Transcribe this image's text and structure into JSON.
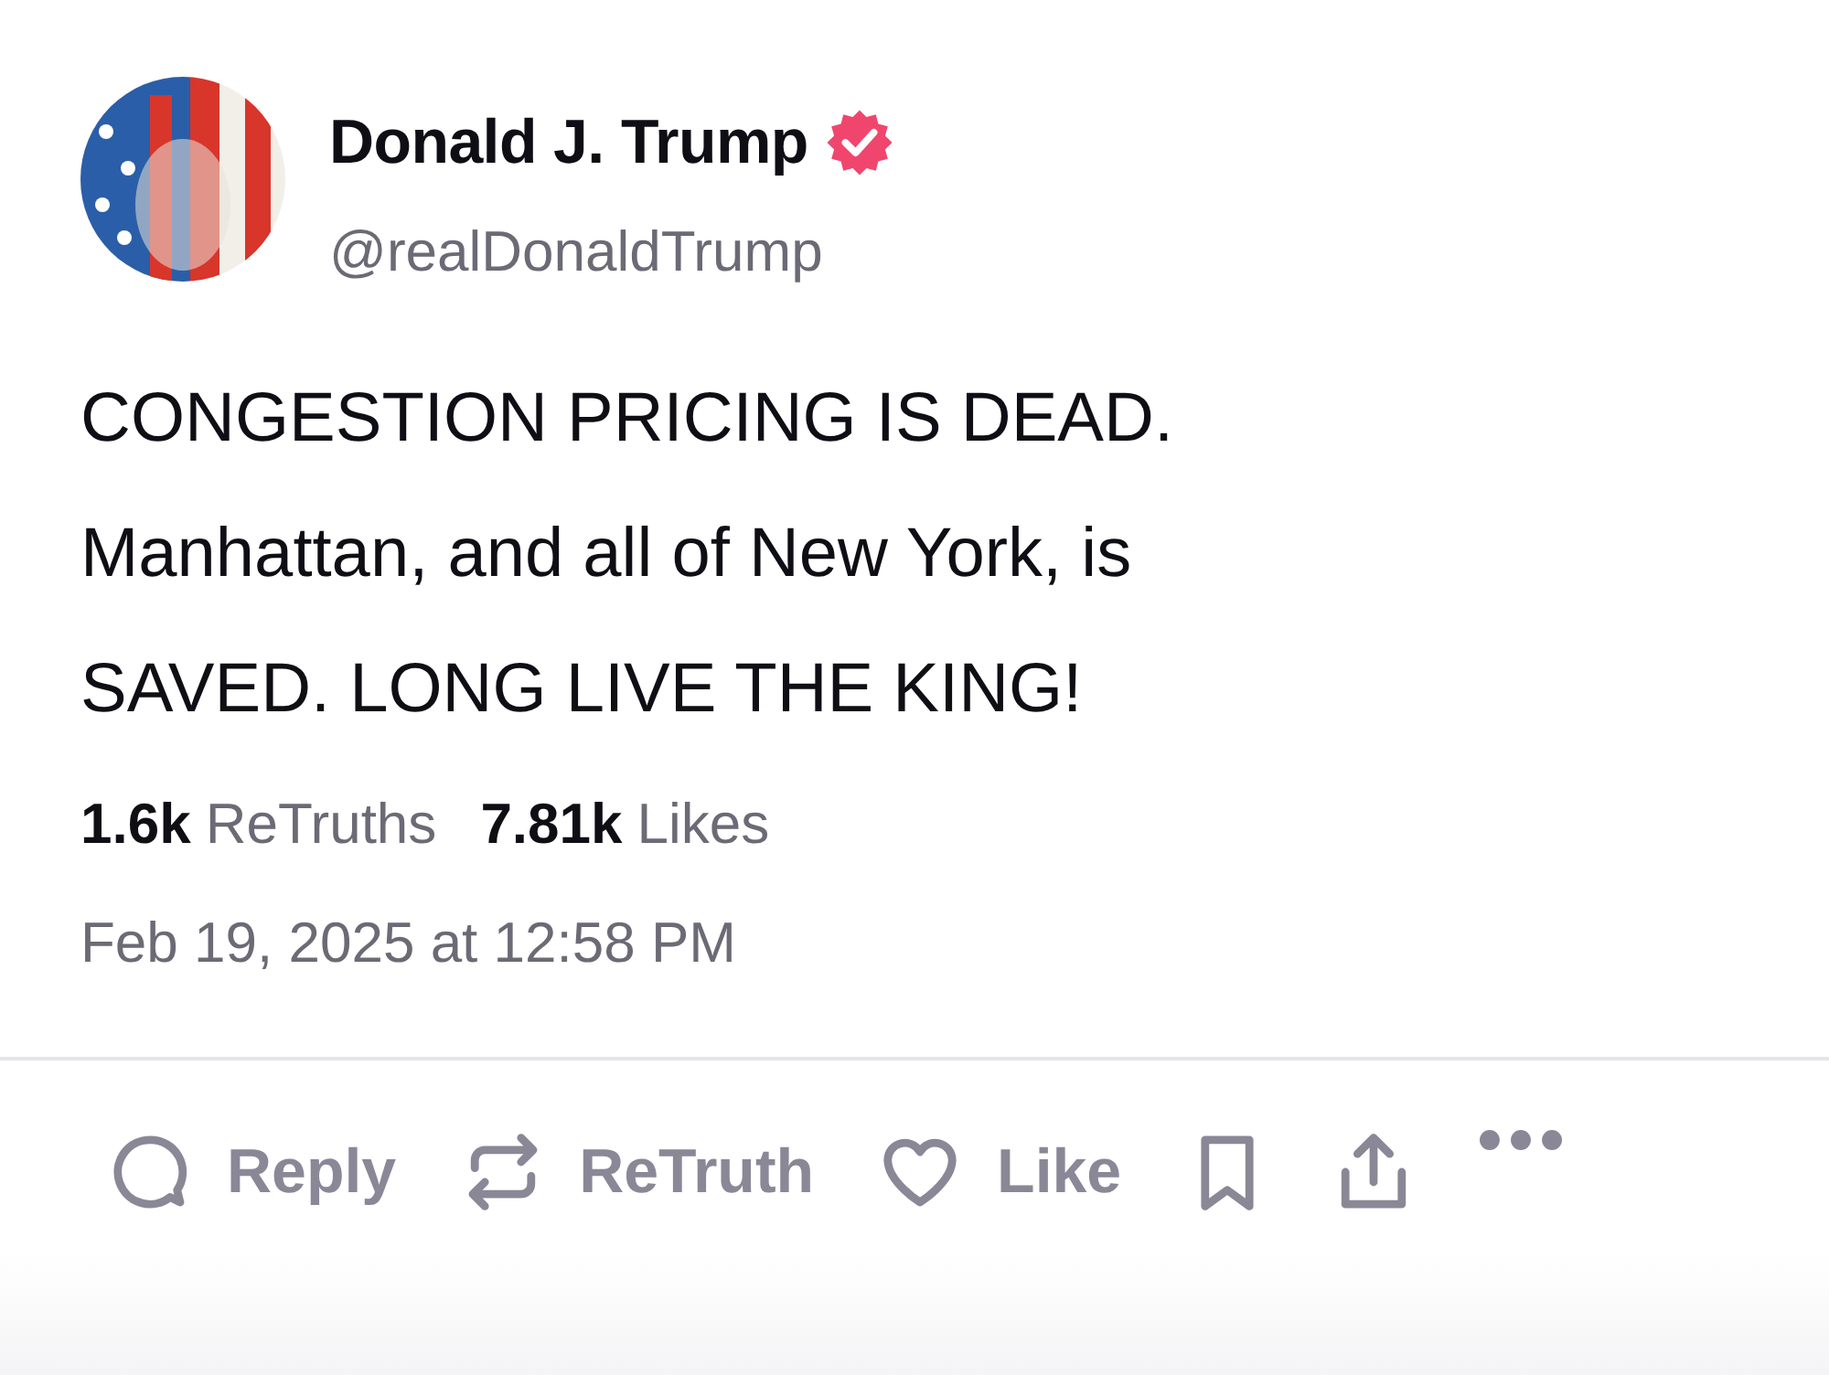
{
  "author": {
    "name": "Donald J. Trump",
    "verified": true,
    "handle": "@realDonaldTrump"
  },
  "post": {
    "lines": [
      "CONGESTION PRICING IS DEAD.",
      "Manhattan, and all of New York, is",
      "SAVED. LONG LIVE THE KING!"
    ]
  },
  "stats": [
    {
      "count": "1.6k",
      "label": "ReTruths"
    },
    {
      "count": "7.81k",
      "label": "Likes"
    }
  ],
  "timestamp": "Feb 19, 2025 at 12:58 PM",
  "actions": [
    {
      "kind": "reply",
      "label": "Reply"
    },
    {
      "kind": "retruth",
      "label": "ReTruth"
    },
    {
      "kind": "like",
      "label": "Like"
    },
    {
      "kind": "bookmark"
    },
    {
      "kind": "share"
    },
    {
      "kind": "more"
    }
  ]
}
